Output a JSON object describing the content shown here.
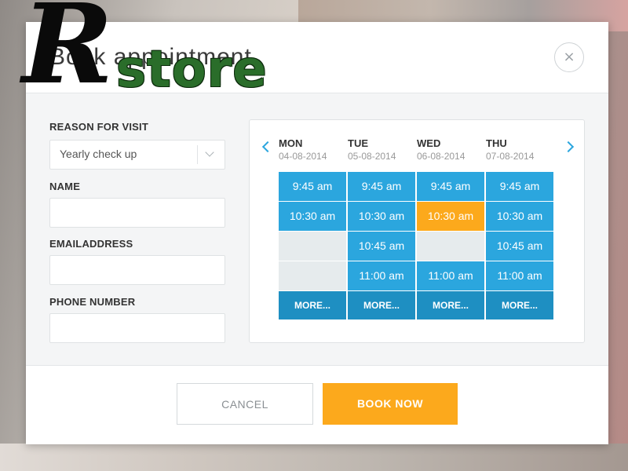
{
  "modal": {
    "title": "Book appointment",
    "close_symbol": "×"
  },
  "form": {
    "reason": {
      "label": "REASON FOR VISIT",
      "value": "Yearly check up"
    },
    "name": {
      "label": "NAME",
      "value": ""
    },
    "email": {
      "label": "EMAILADDRESS",
      "value": ""
    },
    "phone": {
      "label": "PHONE NUMBER",
      "value": ""
    }
  },
  "calendar": {
    "days": [
      {
        "name": "MON",
        "date": "04-08-2014"
      },
      {
        "name": "TUE",
        "date": "05-08-2014"
      },
      {
        "name": "WED",
        "date": "06-08-2014"
      },
      {
        "name": "THU",
        "date": "07-08-2014"
      }
    ],
    "rows": [
      [
        "9:45 am",
        "9:45 am",
        "9:45 am",
        "9:45 am"
      ],
      [
        "10:30 am",
        "10:30 am",
        "10:30 am",
        "10:30 am"
      ],
      [
        "",
        "10:45 am",
        "",
        "10:45 am"
      ],
      [
        "",
        "11:00 am",
        "11:00 am",
        "11:00 am"
      ]
    ],
    "selected_slot": {
      "day": "WED",
      "time": "10:30 am"
    },
    "more_label": "MORE...",
    "colors": {
      "slot": "#2ba6de",
      "selected": "#fca91c",
      "empty": "#e6ebed",
      "more": "#1e8fc2"
    }
  },
  "footer": {
    "cancel_label": "CANCEL",
    "book_label": "BOOK NOW"
  },
  "watermark": {
    "letter": "R",
    "word": "store"
  },
  "icons": {
    "close": "close-icon",
    "prev": "chevron-left-icon",
    "next": "chevron-right-icon",
    "dropdown": "chevron-down-icon"
  }
}
